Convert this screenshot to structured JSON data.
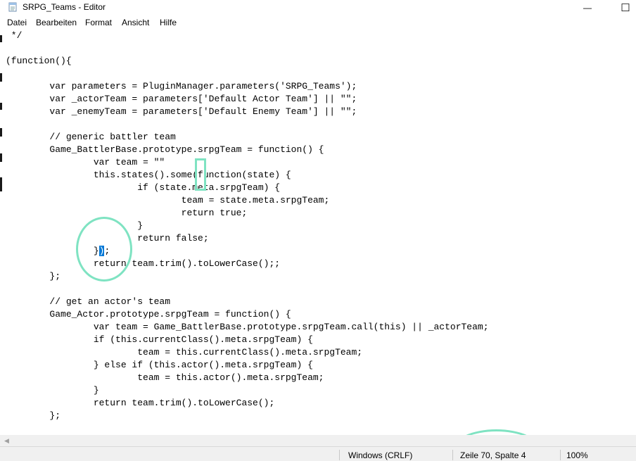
{
  "window": {
    "title": "SRPG_Teams - Editor",
    "minimize_glyph": "—",
    "maximize_glyph": "☐"
  },
  "menu": {
    "items": [
      "Datei",
      "Bearbeiten",
      "Format",
      "Ansicht",
      "Hilfe"
    ]
  },
  "editor": {
    "code_before_selection": " */\n\n(function(){\n\n        var parameters = PluginManager.parameters('SRPG_Teams');\n        var _actorTeam = parameters['Default Actor Team'] || \"\";\n        var _enemyTeam = parameters['Default Enemy Team'] || \"\";\n\n        // generic battler team\n        Game_BattlerBase.prototype.srpgTeam = function() {\n                var team = \"\"\n                this.states().some(function(state) {\n                        if (state.meta.srpgTeam) {\n                                team = state.meta.srpgTeam;\n                                return true;\n                        }\n                        return false;\n                }",
    "selected_text": ")",
    "code_after_selection": ";\n                return team.trim().toLowerCase();;\n        };\n\n        // get an actor's team\n        Game_Actor.prototype.srpgTeam = function() {\n                var team = Game_BattlerBase.prototype.srpgTeam.call(this) || _actorTeam;\n                if (this.currentClass().meta.srpgTeam) {\n                        team = this.currentClass().meta.srpgTeam;\n                } else if (this.actor().meta.srpgTeam) {\n                        team = this.actor().meta.srpgTeam;\n                }\n                return team.trim().toLowerCase();\n        };"
  },
  "statusbar": {
    "line_ending": "Windows (CRLF)",
    "cursor_position": "Zeile 70, Spalte 4",
    "zoom": "100%"
  },
  "colors": {
    "annotation": "#7fe3c2",
    "selection": "#0078d7"
  }
}
